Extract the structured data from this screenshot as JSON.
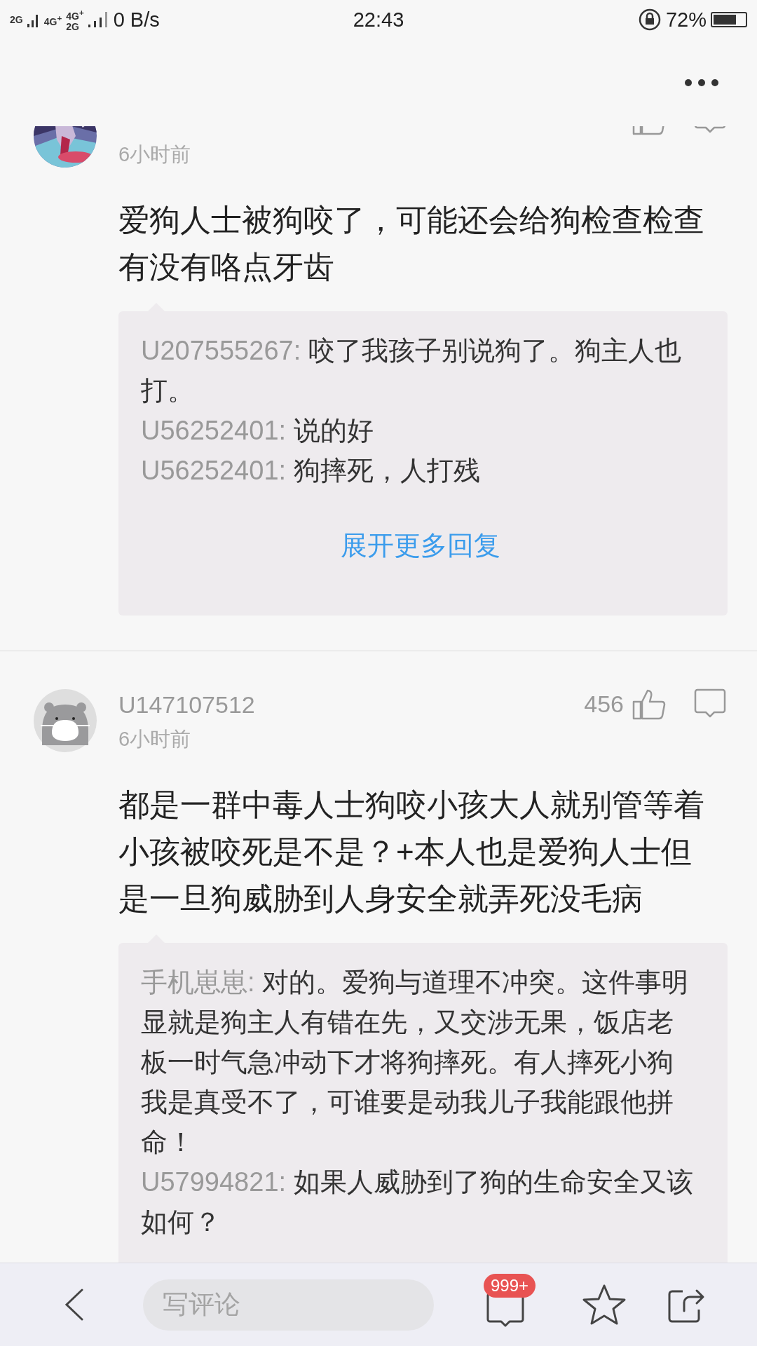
{
  "status_bar": {
    "sim1": "2G",
    "sim2_top": "4G$^{+}$",
    "sim3_top": "4G$^{+}$",
    "sim3_bottom": "2G",
    "speed": "0 B/s",
    "time": "22:43",
    "battery": "72%"
  },
  "comments": [
    {
      "time": "6小时前",
      "text": "爱狗人士被狗咬了，可能还会给狗检查检查有没有咯点牙齿",
      "replies": [
        {
          "user": "U207555267:",
          "text": "咬了我孩子别说狗了。狗主人也打。"
        },
        {
          "user": "U56252401:",
          "text": "说的好"
        },
        {
          "user": "U56252401:",
          "text": "狗摔死，人打残"
        }
      ],
      "more": "展开更多回复"
    },
    {
      "avatar": {
        "kind": "default"
      },
      "user": "U147107512",
      "likes": "456",
      "time": "6小时前",
      "text": "都是一群中毒人士狗咬小孩大人就别管等着小孩被咬死是不是？+本人也是爱狗人士但是一旦狗威胁到人身安全就弄死没毛病",
      "replies": [
        {
          "user": "手机崽崽:",
          "text": "对的。爱狗与道理不冲突。这件事明显就是狗主人有错在先，又交涉无果，饭店老板一时气急冲动下才将狗摔死。有人摔死小狗我是真受不了，可谁要是动我儿子我能跟他拼命！"
        },
        {
          "user": "U57994821:",
          "text": "如果人威胁到了狗的生命安全又该如何？"
        }
      ]
    }
  ],
  "bottom_bar": {
    "placeholder": "写评论",
    "badge": "999+"
  }
}
